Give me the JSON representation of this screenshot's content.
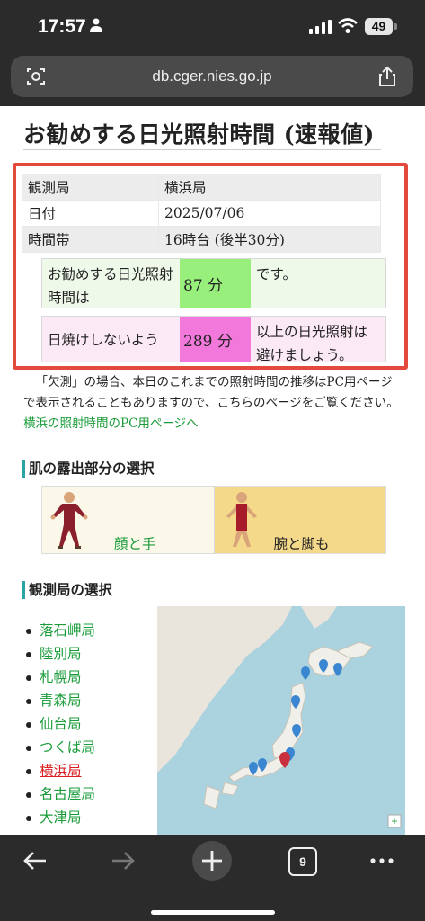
{
  "status_bar": {
    "time": "17:57",
    "battery": "49"
  },
  "browser": {
    "url": "db.cger.nies.go.jp",
    "tab_count": "9"
  },
  "page": {
    "title": "お勧めする日光照射時間 (速報値)",
    "info_table": [
      {
        "key": "観測局",
        "value": "横浜局"
      },
      {
        "key": "日付",
        "value": "2025/07/06"
      },
      {
        "key": "時間帯",
        "value": "16時台 (後半30分)"
      }
    ],
    "recommend": {
      "label": "お勧めする日光照射時間は",
      "value": "87 分",
      "suffix": "です。",
      "color": "#98ef7c"
    },
    "avoid": {
      "label": "日焼けしないよう",
      "value": "289 分",
      "suffix": "以上の日光照射は避けましょう。",
      "color": "#f279db"
    },
    "notice_text": "「欠測」の場合、本日のこれまでの照射時間の推移はPC用ページで表示されることもありますので、こちらのページをご覧ください。",
    "notice_link": "横浜の照射時間のPC用ページへ",
    "skin_section_title": "肌の露出部分の選択",
    "skin_options": [
      {
        "label": "顔と手"
      },
      {
        "label": "腕と脚も"
      }
    ],
    "station_section_title": "観測局の選択",
    "stations": [
      "落石岬局",
      "陸別局",
      "札幌局",
      "青森局",
      "仙台局",
      "つくば局",
      "横浜局",
      "名古屋局",
      "大津局"
    ],
    "active_station": "横浜局"
  },
  "colors": {
    "highlight_border": "#e34a3d",
    "link": "#1a9c3a",
    "active_link": "#d92020"
  }
}
